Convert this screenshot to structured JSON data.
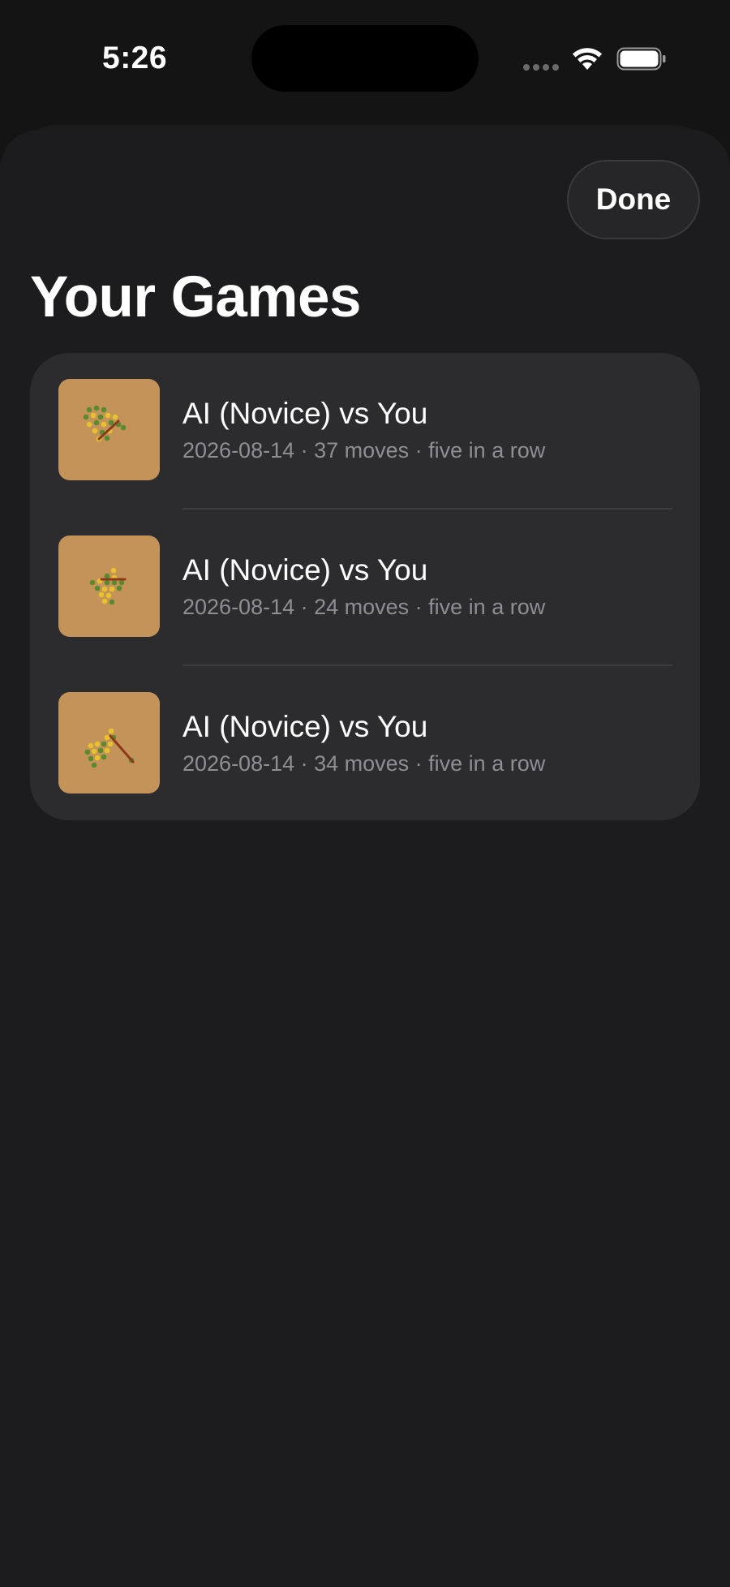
{
  "status_bar": {
    "time": "5:26"
  },
  "sheet": {
    "done_label": "Done",
    "title": "Your Games",
    "games": [
      {
        "title": "AI (Novice) vs You",
        "subtitle": "2026-08-14 · 37 moves · five in a row"
      },
      {
        "title": "AI (Novice) vs You",
        "subtitle": "2026-08-14 · 24 moves · five in a row"
      },
      {
        "title": "AI (Novice) vs You",
        "subtitle": "2026-08-14 · 34 moves · five in a row"
      }
    ]
  },
  "colors": {
    "background": "#1c1c1e",
    "card": "#2c2c2e",
    "board": "#c4935a",
    "stone_green": "#5a8a2e",
    "stone_yellow": "#e8c22c",
    "win_line": "#8b3a1a",
    "secondary_text": "#8e8e93"
  }
}
